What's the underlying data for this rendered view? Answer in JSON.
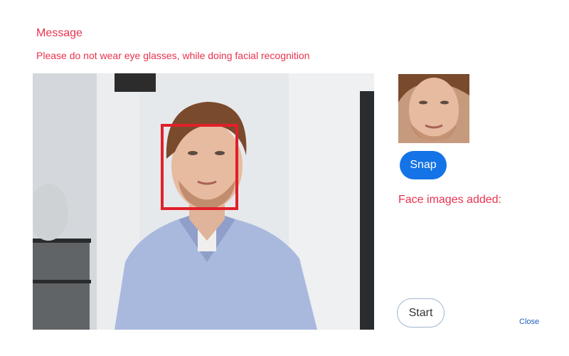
{
  "message": {
    "title": "Message",
    "text": "Please do not wear eye glasses, while doing facial recognition"
  },
  "camera": {
    "feed_icon": "camera-feed",
    "face_box_color": "#e0202a"
  },
  "capture": {
    "thumbnail_icon": "face-thumbnail",
    "snap_label": "Snap",
    "faces_added_label": "Face images added:"
  },
  "footer": {
    "start_label": "Start",
    "close_label": "Close"
  },
  "colors": {
    "accent_red": "#e8334f",
    "primary_blue": "#1473e6",
    "link_blue": "#1f5fbf"
  }
}
